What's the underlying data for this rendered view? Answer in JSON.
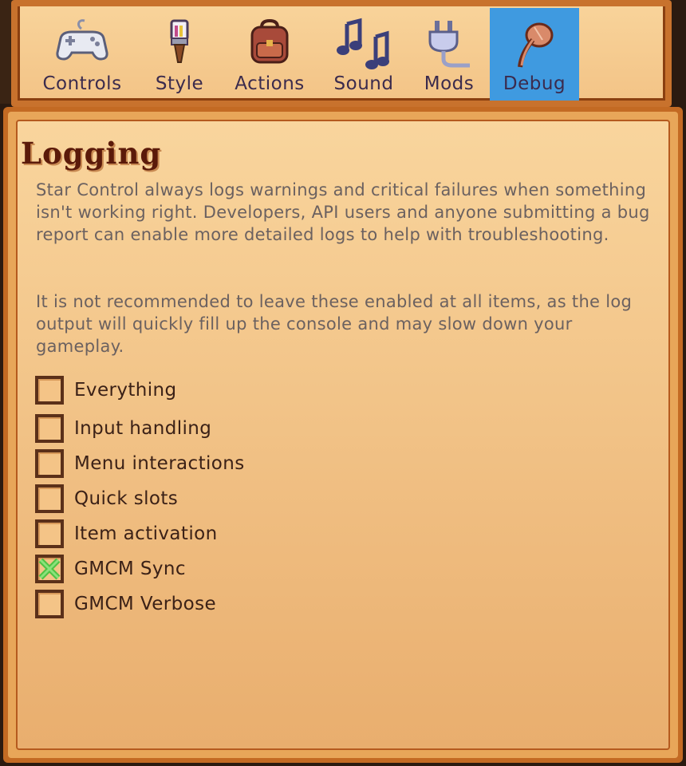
{
  "tabs": [
    {
      "label": "Controls",
      "icon": "gamepad-icon",
      "active": false
    },
    {
      "label": "Style",
      "icon": "paintbrush-icon",
      "active": false
    },
    {
      "label": "Actions",
      "icon": "backpack-icon",
      "active": false
    },
    {
      "label": "Sound",
      "icon": "music-notes-icon",
      "active": false
    },
    {
      "label": "Mods",
      "icon": "plug-icon",
      "active": false
    },
    {
      "label": "Debug",
      "icon": "bug-icon",
      "active": true
    }
  ],
  "section": {
    "title": "Logging",
    "paragraph1": "Star Control always logs warnings and critical failures when something isn't working right. Developers, API users and anyone submitting a bug report can enable more detailed logs to help with troubleshooting.",
    "paragraph2": "It is not recommended to leave these enabled at all items, as the log output will quickly fill up the console and may slow down your gameplay."
  },
  "options": [
    {
      "label": "Everything",
      "checked": false
    },
    {
      "label": "Input handling",
      "checked": false
    },
    {
      "label": "Menu interactions",
      "checked": false
    },
    {
      "label": "Quick slots",
      "checked": false
    },
    {
      "label": "Item activation",
      "checked": false
    },
    {
      "label": "GMCM Sync",
      "checked": true
    },
    {
      "label": "GMCM Verbose",
      "checked": false
    }
  ],
  "colors": {
    "active_tab": "#3f9ae0",
    "panel_border": "#c36a23",
    "title": "#5b1a0a",
    "check_mark": "#4fc244"
  }
}
